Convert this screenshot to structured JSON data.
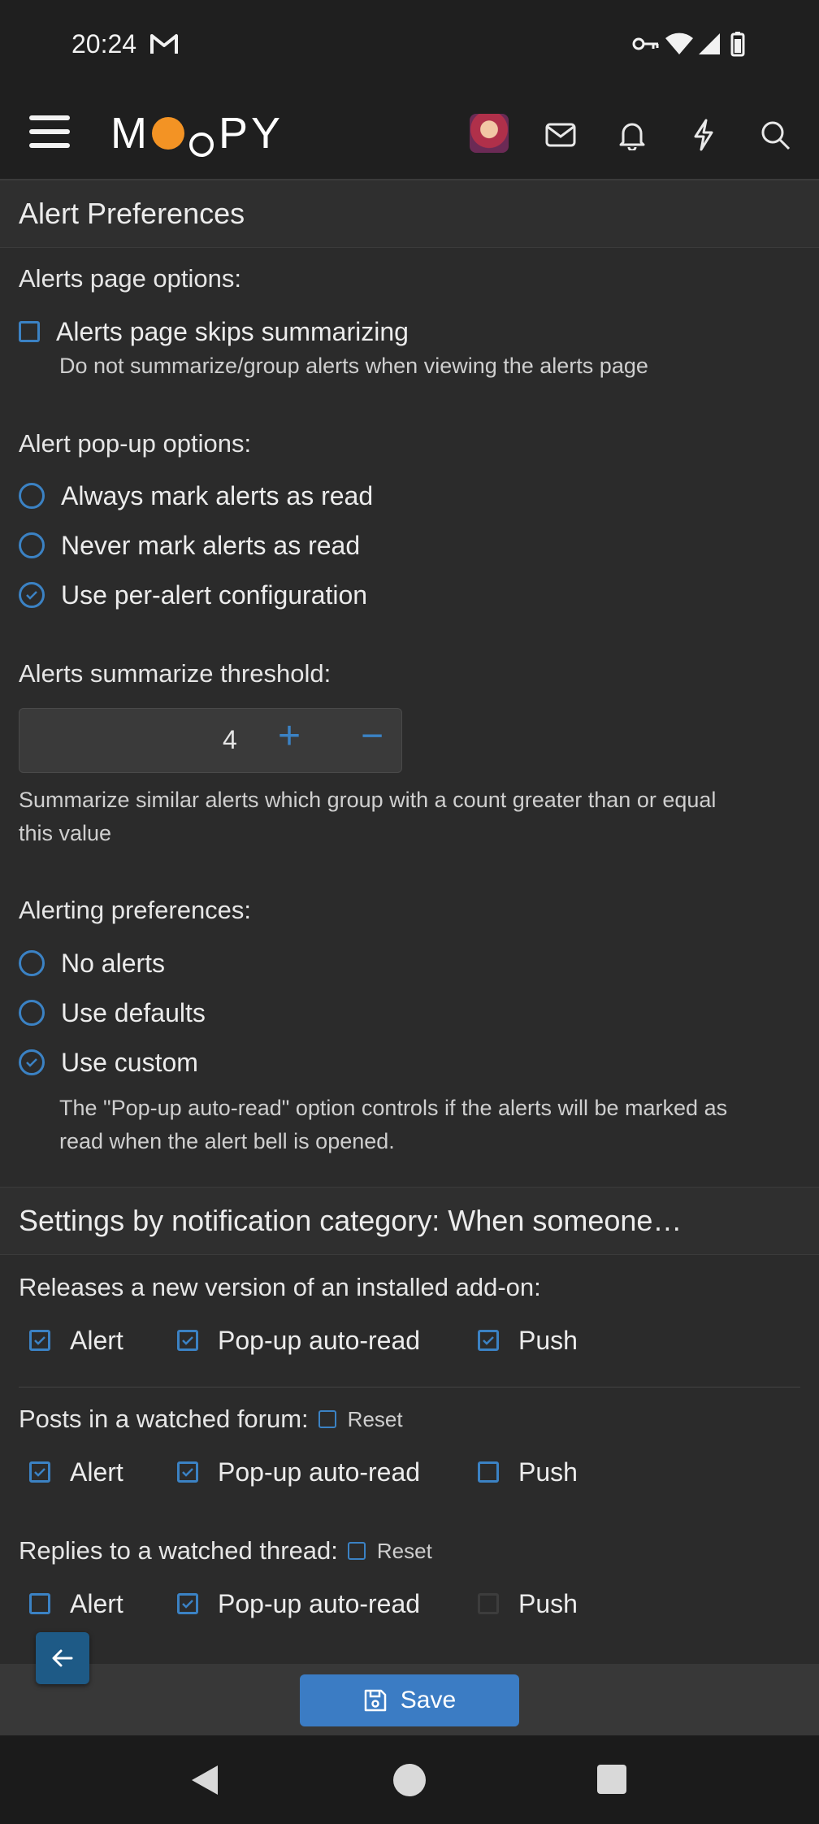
{
  "status_bar": {
    "time": "20:24"
  },
  "header": {
    "logo_text_left": "M",
    "logo_text_right": "PY"
  },
  "alert_preferences": {
    "title": "Alert Preferences",
    "page_options_label": "Alerts page options:",
    "skip_summarizing_label": "Alerts page skips summarizing",
    "skip_summarizing_hint": "Do not summarize/group alerts when viewing the alerts page",
    "popup_options_label": "Alert pop-up options:",
    "popup_options": [
      "Always mark alerts as read",
      "Never mark alerts as read",
      "Use per-alert configuration"
    ],
    "popup_selected": "Use per-alert configuration",
    "threshold_label": "Alerts summarize threshold:",
    "threshold_value": "4",
    "threshold_plus": "+",
    "threshold_minus": "−",
    "threshold_hint_1": "Summarize similar alerts which group with a count greater than or equal",
    "threshold_hint_2": "this value",
    "alerting_label": "Alerting preferences:",
    "alerting_options": [
      "No alerts",
      "Use defaults",
      "Use custom"
    ],
    "alerting_selected": "Use custom",
    "custom_hint_1": "The \"Pop-up auto-read\" option controls if the alerts will be marked as",
    "custom_hint_2": "read when the alert bell is opened."
  },
  "categories": {
    "title": "Settings by notification category: When someone…",
    "items": [
      {
        "label": "Releases a new version of an installed add-on:",
        "alert": "Alert",
        "popup": "Pop-up auto-read",
        "push": "Push",
        "alert_checked": true,
        "popup_checked": true,
        "push_checked": true
      },
      {
        "label": "Posts in a watched forum:",
        "reset": "Reset",
        "alert": "Alert",
        "popup": "Pop-up auto-read",
        "push": "Push",
        "alert_checked": true,
        "popup_checked": true,
        "push_checked": false
      },
      {
        "label": "Replies to a watched thread:",
        "reset": "Reset",
        "alert": "Alert",
        "popup": "Pop-up auto-read",
        "push": "Push",
        "alert_checked": false,
        "popup_checked": true,
        "push_checked": false
      }
    ]
  },
  "footer": {
    "save_label": "Save"
  },
  "colors": {
    "accent": "#3b82c4",
    "logo_orange": "#f39324",
    "background": "#2b2b2b"
  }
}
